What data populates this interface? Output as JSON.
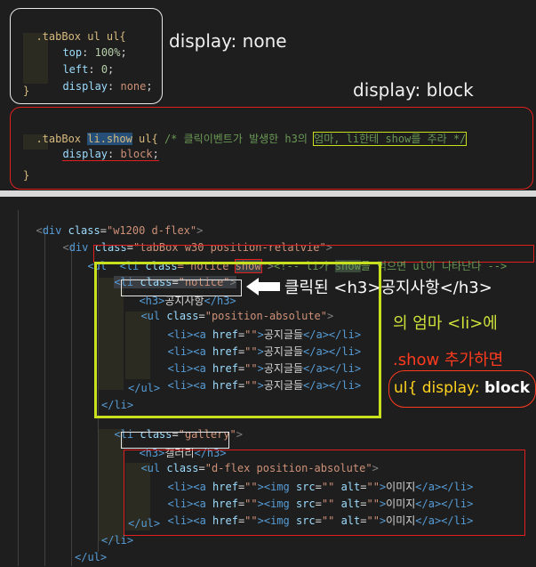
{
  "css_block_1": {
    "line1": ".tabBox ul ul{",
    "l2_prop": "top",
    "l2_val": "100%",
    "l3_prop": "left",
    "l3_val": "0",
    "l4_prop": "display",
    "l4_val": "none",
    "line5": "}"
  },
  "label_display_none": "display: none",
  "label_display_block": "display: block",
  "css_block_2": {
    "sel_a": ".tabBox ",
    "sel_b": "li.show",
    "sel_c": " ul{ ",
    "comment_a": "/* 클릭이벤트가 발생한 h3의 ",
    "comment_b": "엄마, li한테 show를 주라 */",
    "l2_prop": "display",
    "l2_val": "block",
    "line3": "}"
  },
  "html_code": {
    "line1": [
      "<",
      "div",
      " class",
      "=",
      "\"w1200 d-flex\"",
      ">"
    ],
    "line2": [
      "<",
      "div",
      " class",
      "=",
      "\"tabBox w30 position-relatvie\"",
      ">"
    ],
    "line3_pre": "<ul",
    "line3_li": "<li",
    "line3_attr": " class",
    "line3_str_a": "=\"notice ",
    "line3_show": "show",
    "line3_str_b": "\"",
    "line3_close": ">",
    "line3_comment_a": "<!-- li가 ",
    "line3_comment_show": "show",
    "line3_comment_b": "를 먹으면 ul이 나타난다 -->",
    "line4": [
      "<li",
      " class",
      "=",
      "\"notice\"",
      ">"
    ],
    "line5_open": "<h3>",
    "line5_text": "공지사항",
    "line5_close": "</h3>",
    "line6": [
      "<ul",
      " class",
      "=",
      "\"position-absolute\"",
      ">"
    ],
    "list_item_text": "공지글들",
    "line10": "</ul>",
    "line11": "</li>",
    "line12": [
      "<li",
      " class",
      "=",
      "\"gallery\"",
      ">"
    ],
    "line13_open": "<h3>",
    "line13_text": "갤러리",
    "line13_close": "</h3>",
    "line14": [
      "<ul",
      " class",
      "=",
      "\"d-flex position-absolute\"",
      ">"
    ],
    "image_text": "이미지",
    "line18": "</ul>",
    "line19": "</li>",
    "line20": "</ul>"
  },
  "annotation": {
    "clicked_a": "클릭된 ",
    "clicked_b": "<h3>",
    "clicked_c": "공지사항",
    "clicked_d": "</h3>",
    "mom_a": "의 엄마 ",
    "mom_b": "<li>",
    "mom_c": "에",
    "show_a": ".show ",
    "show_b": "추가",
    "show_c": "하면",
    "ul_a": "ul{ display: ",
    "ul_b": "block",
    "ul_c": " }"
  },
  "colors": {
    "red": "#e0201f",
    "yellow_green": "#c8e01e",
    "annotation_green": "#cfe23a",
    "annotation_red": "#ff3b1f"
  }
}
